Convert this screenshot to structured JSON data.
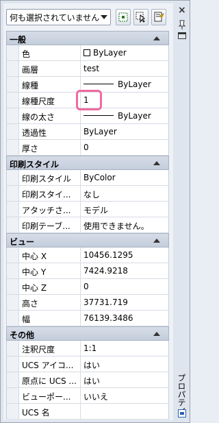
{
  "toolbar": {
    "selection": "何も選択されていません",
    "quick_select_icon": "quick-select-icon",
    "select_objects_icon": "select-objects-icon",
    "toggle_pickadd_icon": "pickadd-icon"
  },
  "palette": {
    "title": "プロパティ",
    "close": "×"
  },
  "categories": [
    {
      "label": "一般",
      "rows": [
        {
          "name": "色",
          "value": "ByLayer"
        },
        {
          "name": "画層",
          "value": "test"
        },
        {
          "name": "線種",
          "value": "ByLayer"
        },
        {
          "name": "線種尺度",
          "value": "1"
        },
        {
          "name": "線の太さ",
          "value": "ByLayer"
        },
        {
          "name": "透過性",
          "value": "ByLayer"
        },
        {
          "name": "厚さ",
          "value": "0"
        }
      ]
    },
    {
      "label": "印刷スタイル",
      "rows": [
        {
          "name": "印刷スタイル",
          "value": "ByColor"
        },
        {
          "name": "印刷スタイ...",
          "value": "なし"
        },
        {
          "name": "アタッチさ...",
          "value": "モデル"
        },
        {
          "name": "印刷テーブ...",
          "value": "使用できません。"
        }
      ]
    },
    {
      "label": "ビュー",
      "rows": [
        {
          "name": "中心 X",
          "value": "10456.1295"
        },
        {
          "name": "中心 Y",
          "value": "7424.9218"
        },
        {
          "name": "中心 Z",
          "value": "0"
        },
        {
          "name": "高さ",
          "value": "37731.719"
        },
        {
          "name": "幅",
          "value": "76139.3486"
        }
      ]
    },
    {
      "label": "その他",
      "rows": [
        {
          "name": "注釈尺度",
          "value": "1:1"
        },
        {
          "name": "UCS アイコ...",
          "value": "はい"
        },
        {
          "name": "原点に UCS ...",
          "value": "はい"
        },
        {
          "name": "ビューポー...",
          "value": "いいえ"
        },
        {
          "name": "UCS 名",
          "value": ""
        }
      ]
    }
  ]
}
